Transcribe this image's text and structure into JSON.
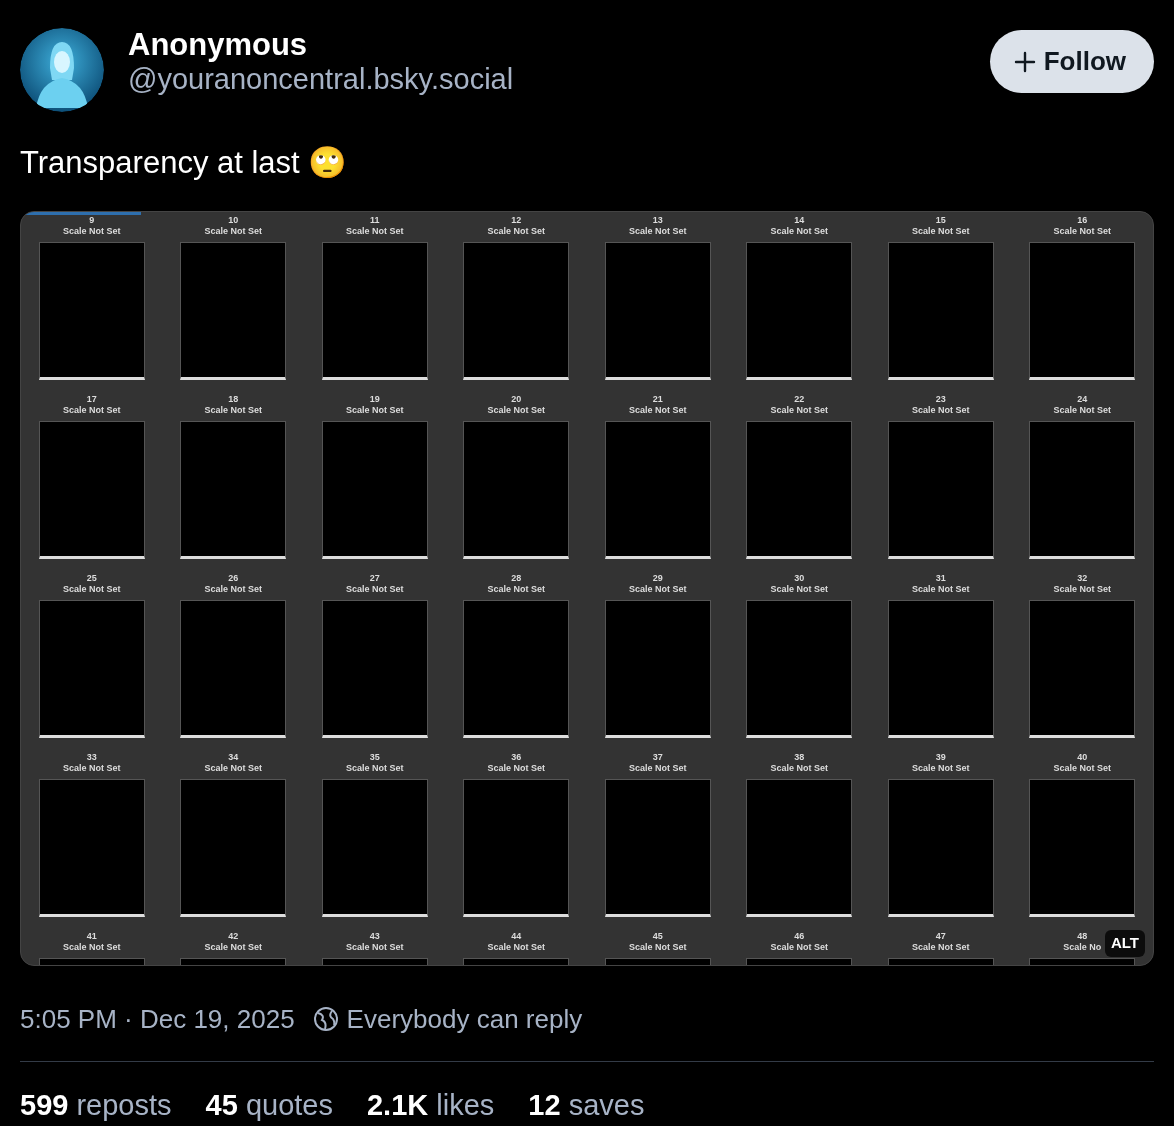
{
  "author": {
    "name": "Anonymous",
    "handle": "@youranoncentral.bsky.social"
  },
  "follow_button": {
    "label": "Follow"
  },
  "post_text": "Transparency at last 🙄",
  "image": {
    "alt_badge": "ALT",
    "tiles": [
      {
        "number": "9",
        "label": "Scale Not Set",
        "selected": true
      },
      {
        "number": "10",
        "label": "Scale Not Set",
        "selected": false
      },
      {
        "number": "11",
        "label": "Scale Not Set",
        "selected": false
      },
      {
        "number": "12",
        "label": "Scale Not Set",
        "selected": false
      },
      {
        "number": "13",
        "label": "Scale Not Set",
        "selected": false
      },
      {
        "number": "14",
        "label": "Scale Not Set",
        "selected": false
      },
      {
        "number": "15",
        "label": "Scale Not Set",
        "selected": false
      },
      {
        "number": "16",
        "label": "Scale Not Set",
        "selected": false
      },
      {
        "number": "17",
        "label": "Scale Not Set",
        "selected": false
      },
      {
        "number": "18",
        "label": "Scale Not Set",
        "selected": false
      },
      {
        "number": "19",
        "label": "Scale Not Set",
        "selected": false
      },
      {
        "number": "20",
        "label": "Scale Not Set",
        "selected": false
      },
      {
        "number": "21",
        "label": "Scale Not Set",
        "selected": false
      },
      {
        "number": "22",
        "label": "Scale Not Set",
        "selected": false
      },
      {
        "number": "23",
        "label": "Scale Not Set",
        "selected": false
      },
      {
        "number": "24",
        "label": "Scale Not Set",
        "selected": false
      },
      {
        "number": "25",
        "label": "Scale Not Set",
        "selected": false
      },
      {
        "number": "26",
        "label": "Scale Not Set",
        "selected": false
      },
      {
        "number": "27",
        "label": "Scale Not Set",
        "selected": false
      },
      {
        "number": "28",
        "label": "Scale Not Set",
        "selected": false
      },
      {
        "number": "29",
        "label": "Scale Not Set",
        "selected": false
      },
      {
        "number": "30",
        "label": "Scale Not Set",
        "selected": false
      },
      {
        "number": "31",
        "label": "Scale Not Set",
        "selected": false
      },
      {
        "number": "32",
        "label": "Scale Not Set",
        "selected": false
      },
      {
        "number": "33",
        "label": "Scale Not Set",
        "selected": false
      },
      {
        "number": "34",
        "label": "Scale Not Set",
        "selected": false
      },
      {
        "number": "35",
        "label": "Scale Not Set",
        "selected": false
      },
      {
        "number": "36",
        "label": "Scale Not Set",
        "selected": false
      },
      {
        "number": "37",
        "label": "Scale Not Set",
        "selected": false
      },
      {
        "number": "38",
        "label": "Scale Not Set",
        "selected": false
      },
      {
        "number": "39",
        "label": "Scale Not Set",
        "selected": false
      },
      {
        "number": "40",
        "label": "Scale Not Set",
        "selected": false
      },
      {
        "number": "41",
        "label": "Scale Not Set",
        "selected": false
      },
      {
        "number": "42",
        "label": "Scale Not Set",
        "selected": false
      },
      {
        "number": "43",
        "label": "Scale Not Set",
        "selected": false
      },
      {
        "number": "44",
        "label": "Scale Not Set",
        "selected": false
      },
      {
        "number": "45",
        "label": "Scale Not Set",
        "selected": false
      },
      {
        "number": "46",
        "label": "Scale Not Set",
        "selected": false
      },
      {
        "number": "47",
        "label": "Scale Not Set",
        "selected": false
      },
      {
        "number": "48",
        "label": "Scale No",
        "selected": false
      }
    ]
  },
  "meta": {
    "timestamp": "5:05 PM · Dec 19, 2025",
    "reply_setting": "Everybody can reply"
  },
  "stats": [
    {
      "text": "**599** reposts"
    },
    {
      "text": "**45** quotes"
    },
    {
      "text": "**2.1K** likes"
    },
    {
      "text": "**12** saves"
    }
  ]
}
